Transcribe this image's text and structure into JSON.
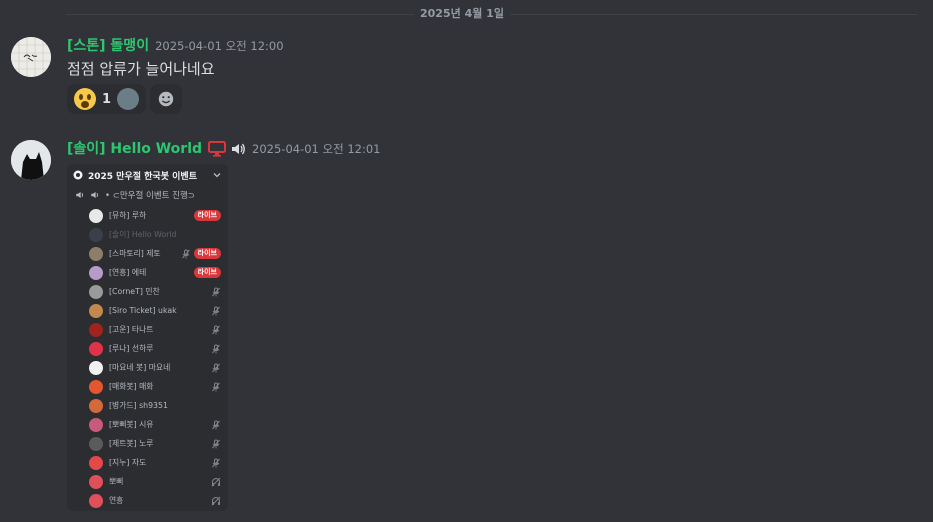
{
  "date_divider": "2025년 4월 1일",
  "messages": [
    {
      "username": "[스톤] 돌맹이",
      "timestamp": "2025-04-01 오전 12:00",
      "content": "점점 압류가 늘어나네요",
      "reactions": [
        {
          "emoji": "scream-emoji",
          "count": "1"
        }
      ]
    },
    {
      "username": "[솔이] Hello World",
      "timestamp": "2025-04-01 오전 12:01",
      "embed": {
        "server_name": "2025 만우절 한국봇 이벤트",
        "channel_name": "• ⊂만우절 이벤트 진행⊃",
        "live_label": "라이브",
        "users": [
          {
            "name": "[뮤하] 루하",
            "status": "live",
            "color": "#e8e8e8"
          },
          {
            "name": "[솔이] Hello World",
            "status": "none",
            "muted": true,
            "color": "#3a3f4a"
          },
          {
            "name": "[스마토리] 제토",
            "status": "mute-live",
            "color": "#8c7f6a"
          },
          {
            "name": "[연흥] 에테",
            "status": "live",
            "color": "#b89ac9"
          },
          {
            "name": "[CorneT] 민찬",
            "status": "mute",
            "color": "#9a9a9a"
          },
          {
            "name": "[Siro Ticket] ukak",
            "status": "mute",
            "color": "#c2884e"
          },
          {
            "name": "[고운] 타나트",
            "status": "mute",
            "color": "#a0231e"
          },
          {
            "name": "[루나] 선하루",
            "status": "mute",
            "color": "#e0334a"
          },
          {
            "name": "[마요네 봇] 마요네",
            "status": "mute",
            "color": "#f1f1f1"
          },
          {
            "name": "[매화봇] 매화",
            "status": "mute",
            "color": "#e4572e"
          },
          {
            "name": "[병가드] sh9351",
            "status": "none",
            "color": "#d4693a"
          },
          {
            "name": "[뽀삐봇] 시유",
            "status": "mute",
            "color": "#c65b7c"
          },
          {
            "name": "[제트봇] 노루",
            "status": "mute",
            "color": "#5b5b5b"
          },
          {
            "name": "[지누] 자도",
            "status": "mute",
            "color": "#e54848"
          },
          {
            "name": "뽀삐",
            "status": "deafen",
            "color": "#e0505a"
          },
          {
            "name": "연흥",
            "status": "deafen",
            "color": "#e0505a"
          }
        ]
      }
    }
  ],
  "colors": {
    "background": "#313338",
    "username": "#2dc770",
    "live_badge": "#da373c",
    "monitor_icon": "#da373c"
  }
}
